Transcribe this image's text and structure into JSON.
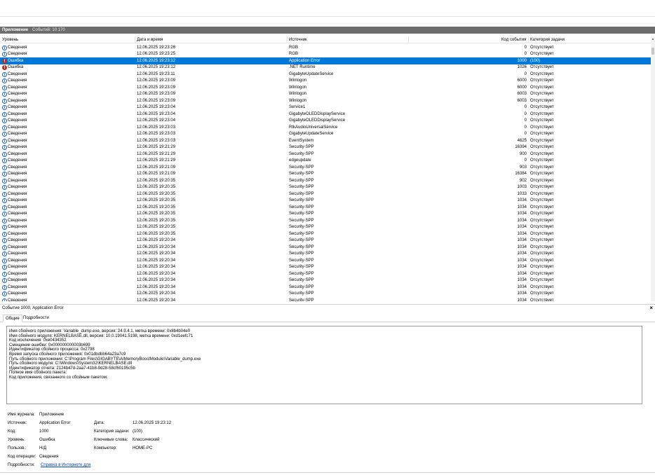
{
  "log": {
    "name": "Приложение",
    "count_label": "Событий: 10 170"
  },
  "columns": {
    "level": "Уровень",
    "date": "Дата и время",
    "source": "Источник",
    "event_id": "Код события",
    "category": "Категория задачи"
  },
  "rows": [
    {
      "level": "Сведения",
      "type": "info",
      "date": "12.06.2025 19:23:26",
      "source": "RGB",
      "id": "0",
      "cat": "Отсутствует"
    },
    {
      "level": "Сведения",
      "type": "info",
      "date": "12.06.2025 19:23:25",
      "source": "RGB",
      "id": "0",
      "cat": "Отсутствует"
    },
    {
      "level": "Ошибка",
      "type": "err",
      "date": "12.06.2025 19:23:12",
      "source": "Application Error",
      "id": "1000",
      "cat": "(100)",
      "selected": true
    },
    {
      "level": "Ошибка",
      "type": "err",
      "date": "12.06.2025 19:23:12",
      "source": ".NET Runtime",
      "id": "1026",
      "cat": "Отсутствует"
    },
    {
      "level": "Сведения",
      "type": "info",
      "date": "12.06.2025 19:23:11",
      "source": "GigabyteUpdateService",
      "id": "0",
      "cat": "Отсутствует"
    },
    {
      "level": "Сведения",
      "type": "info",
      "date": "12.06.2025 19:23:09",
      "source": "Winlogon",
      "id": "6000",
      "cat": "Отсутствует"
    },
    {
      "level": "Сведения",
      "type": "info",
      "date": "12.06.2025 19:23:09",
      "source": "Winlogon",
      "id": "6000",
      "cat": "Отсутствует"
    },
    {
      "level": "Сведения",
      "type": "info",
      "date": "12.06.2025 19:23:09",
      "source": "Winlogon",
      "id": "6003",
      "cat": "Отсутствует"
    },
    {
      "level": "Сведения",
      "type": "info",
      "date": "12.06.2025 19:23:09",
      "source": "Winlogon",
      "id": "6003",
      "cat": "Отсутствует"
    },
    {
      "level": "Сведения",
      "type": "info",
      "date": "12.06.2025 19:23:04",
      "source": "Service1",
      "id": "0",
      "cat": "Отсутствует"
    },
    {
      "level": "Сведения",
      "type": "info",
      "date": "12.06.2025 19:23:04",
      "source": "GigabyteOLEDDisplayService",
      "id": "0",
      "cat": "Отсутствует"
    },
    {
      "level": "Сведения",
      "type": "info",
      "date": "12.06.2025 19:23:04",
      "source": "GigabyteOLEDDisplayService",
      "id": "0",
      "cat": "Отсутствует"
    },
    {
      "level": "Сведения",
      "type": "info",
      "date": "12.06.2025 19:23:03",
      "source": "RtkAudioUniversalService",
      "id": "0",
      "cat": "Отсутствует"
    },
    {
      "level": "Сведения",
      "type": "info",
      "date": "12.06.2025 19:23:03",
      "source": "GigabyteUpdateService",
      "id": "0",
      "cat": "Отсутствует"
    },
    {
      "level": "Сведения",
      "type": "info",
      "date": "12.06.2025 19:23:03",
      "source": "EventSystem",
      "id": "4625",
      "cat": "Отсутствует"
    },
    {
      "level": "Сведения",
      "type": "info",
      "date": "12.06.2025 19:21:29",
      "source": "Security-SPP",
      "id": "16394",
      "cat": "Отсутствует"
    },
    {
      "level": "Сведения",
      "type": "info",
      "date": "12.06.2025 19:21:29",
      "source": "Security-SPP",
      "id": "900",
      "cat": "Отсутствует"
    },
    {
      "level": "Сведения",
      "type": "info",
      "date": "12.06.2025 19:21:29",
      "source": "edgeupdate",
      "id": "0",
      "cat": "Отсутствует"
    },
    {
      "level": "Сведения",
      "type": "info",
      "date": "12.06.2025 19:21:09",
      "source": "Security-SPP",
      "id": "903",
      "cat": "Отсутствует"
    },
    {
      "level": "Сведения",
      "type": "info",
      "date": "12.06.2025 19:21:09",
      "source": "Security-SPP",
      "id": "16384",
      "cat": "Отсутствует"
    },
    {
      "level": "Сведения",
      "type": "info",
      "date": "12.06.2025 19:20:35",
      "source": "Security-SPP",
      "id": "902",
      "cat": "Отсутствует"
    },
    {
      "level": "Сведения",
      "type": "info",
      "date": "12.06.2025 19:20:35",
      "source": "Security-SPP",
      "id": "1003",
      "cat": "Отсутствует"
    },
    {
      "level": "Сведения",
      "type": "info",
      "date": "12.06.2025 19:20:35",
      "source": "Security-SPP",
      "id": "1033",
      "cat": "Отсутствует"
    },
    {
      "level": "Сведения",
      "type": "info",
      "date": "12.06.2025 19:20:35",
      "source": "Security-SPP",
      "id": "1034",
      "cat": "Отсутствует"
    },
    {
      "level": "Сведения",
      "type": "info",
      "date": "12.06.2025 19:20:35",
      "source": "Security-SPP",
      "id": "1034",
      "cat": "Отсутствует"
    },
    {
      "level": "Сведения",
      "type": "info",
      "date": "12.06.2025 19:20:35",
      "source": "Security-SPP",
      "id": "1034",
      "cat": "Отсутствует"
    },
    {
      "level": "Сведения",
      "type": "info",
      "date": "12.06.2025 19:20:35",
      "source": "Security-SPP",
      "id": "1034",
      "cat": "Отсутствует"
    },
    {
      "level": "Сведения",
      "type": "info",
      "date": "12.06.2025 19:20:35",
      "source": "Security-SPP",
      "id": "1034",
      "cat": "Отсутствует"
    },
    {
      "level": "Сведения",
      "type": "info",
      "date": "12.06.2025 19:20:35",
      "source": "Security-SPP",
      "id": "1034",
      "cat": "Отсутствует"
    },
    {
      "level": "Сведения",
      "type": "info",
      "date": "12.06.2025 19:20:34",
      "source": "Security-SPP",
      "id": "1034",
      "cat": "Отсутствует"
    },
    {
      "level": "Сведения",
      "type": "info",
      "date": "12.06.2025 19:20:34",
      "source": "Security-SPP",
      "id": "1034",
      "cat": "Отсутствует"
    },
    {
      "level": "Сведения",
      "type": "info",
      "date": "12.06.2025 19:20:34",
      "source": "Security-SPP",
      "id": "1034",
      "cat": "Отсутствует"
    },
    {
      "level": "Сведения",
      "type": "info",
      "date": "12.06.2025 19:20:34",
      "source": "Security-SPP",
      "id": "1034",
      "cat": "Отсутствует"
    },
    {
      "level": "Сведения",
      "type": "info",
      "date": "12.06.2025 19:20:34",
      "source": "Security-SPP",
      "id": "1034",
      "cat": "Отсутствует"
    },
    {
      "level": "Сведения",
      "type": "info",
      "date": "12.06.2025 19:20:34",
      "source": "Security-SPP",
      "id": "1034",
      "cat": "Отсутствует"
    },
    {
      "level": "Сведения",
      "type": "info",
      "date": "12.06.2025 19:20:34",
      "source": "Security-SPP",
      "id": "1034",
      "cat": "Отсутствует"
    },
    {
      "level": "Сведения",
      "type": "info",
      "date": "12.06.2025 19:20:34",
      "source": "Security-SPP",
      "id": "1034",
      "cat": "Отсутствует"
    },
    {
      "level": "Сведения",
      "type": "info",
      "date": "12.06.2025 19:20:34",
      "source": "Security-SPP",
      "id": "1034",
      "cat": "Отсутствует"
    },
    {
      "level": "Сведения",
      "type": "info",
      "date": "12.06.2025 19:20:34",
      "source": "Security-SPP",
      "id": "1034",
      "cat": "Отсутствует"
    }
  ],
  "detail": {
    "title": "Событие 1000, Application Error",
    "close": "×",
    "tab_general": "Общие",
    "tab_details": "Подробности",
    "description": [
      "Имя сбойного приложения: Variable_dump.exe, версия: 24.9.4.1, метка времени: 0x8b4b04e0",
      "Имя сбойного модуля: KERNELBASE.dll, версия: 10.0.19041.5198, метка времени: 0xd1eefc71",
      "Код исключения: 0xe0434352",
      "Смещение ошибки: 0x000000000003b699",
      "Идентификатор сбойного процесса: 0x2798",
      "Время запуска сбойного приложения: 0x01dbdbb64a23a7c9",
      "Путь сбойного приложения: C:\\Program Files\\GIGABYTE\\AIMemoryBoostModule\\Variable_dump.exe",
      "Путь сбойного модуля: C:\\Windows\\System32\\KERNELBASE.dll",
      "Идентификатор отчета: 2124b47d-2aa7-41b8-9d28-58cf60195c5b",
      "Полное имя сбойного пакета:",
      "Код приложения, связанного со сбойным пакетом:"
    ],
    "props": {
      "log_name_label": "Имя журнала:",
      "log_name_value": "Приложение",
      "source_label": "Источник:",
      "source_value": "Application Error",
      "date_label": "Дата:",
      "date_value": "12.06.2025 19:23:12",
      "code_label": "Код:",
      "code_value": "1000",
      "category_label": "Категория задачи:",
      "category_value": "(100)",
      "level_label": "Уровень:",
      "level_value": "Ошибка",
      "keywords_label": "Ключевые слова:",
      "keywords_value": "Классический",
      "user_label": "Пользов.:",
      "user_value": "Н/Д",
      "computer_label": "Компьютер:",
      "computer_value": "HOME-PC",
      "opcode_label": "Код операции:",
      "opcode_value": "Сведения",
      "more_label": "Подробности:",
      "more_link": "Справка в Интернете для"
    }
  }
}
